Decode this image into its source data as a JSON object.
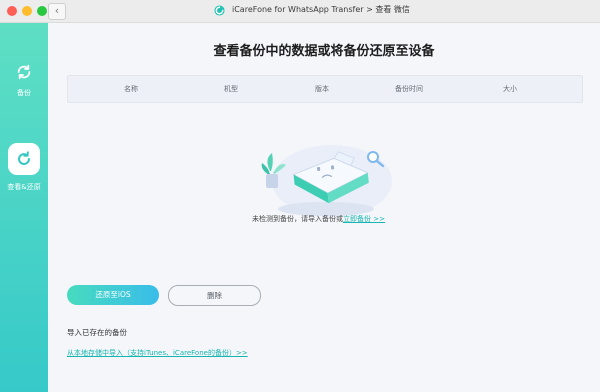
{
  "window": {
    "title": "iCareFone for WhatsApp Transfer > 查看 微信",
    "back_glyph": "‹"
  },
  "sidebar": {
    "items": [
      {
        "label": "备份",
        "icon": "refresh-icon"
      },
      {
        "label": "查看&还原",
        "icon": "restore-icon"
      }
    ]
  },
  "main": {
    "title": "查看备份中的数据或将备份还原至设备",
    "table": {
      "columns": [
        "名称",
        "机型",
        "版本",
        "备份时间",
        "大小"
      ]
    },
    "empty": {
      "text": "未检测到备份，请导入备份或",
      "link": "立即备份 >>"
    },
    "buttons": {
      "restore": "还原至iOS",
      "delete": "删除"
    },
    "import": {
      "title": "导入已存在的备份",
      "link": "从本地存储中导入（支持iTunes、iCareFone的备份）>>"
    }
  },
  "colors": {
    "accent": "#16b5b0",
    "sidebar_top": "#5edfc4",
    "sidebar_bottom": "#36c9c9",
    "restore_btn_start": "#47dbbf",
    "restore_btn_end": "#39bde9"
  }
}
